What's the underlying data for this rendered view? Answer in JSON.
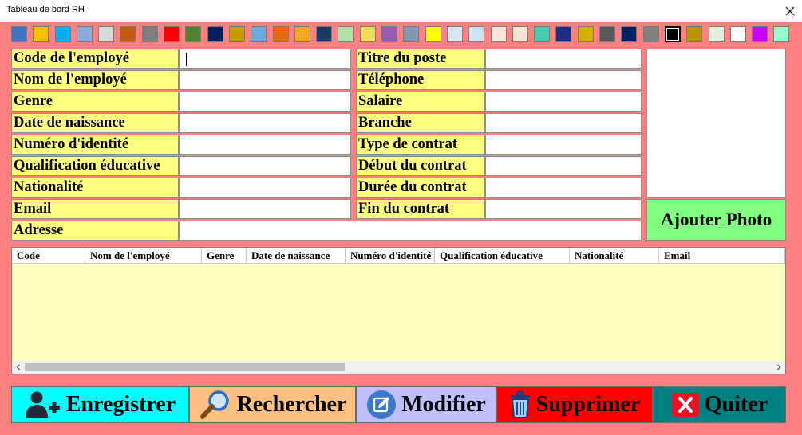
{
  "window": {
    "title": "Tableau de bord RH",
    "close_icon": "close-icon"
  },
  "palette": {
    "swatches": [
      "#4472c4",
      "#ffc000",
      "#00b0f0",
      "#8ea9db",
      "#d9d9d9",
      "#c55a11",
      "#7f7f7f",
      "#ff0000",
      "#548235",
      "#002060",
      "#c99a00",
      "#6fa8dc",
      "#e46c0a",
      "#f5a623",
      "#1f3864",
      "#b4e1a8",
      "#f2dc5d",
      "#9b59b6",
      "#8496b0",
      "#ffff00",
      "#dbe5f1",
      "#cfe2f3",
      "#fce4d6",
      "#fbe4d5",
      "#48c9b0",
      "#1f2d86",
      "#d4b000",
      "#595959",
      "#002060",
      "#808080",
      "#000000",
      "#bf9000",
      "#e2efda",
      "#ffffff",
      "#cc00ff",
      "#99ffcc"
    ],
    "selected_index": 30
  },
  "form": {
    "left_labels": [
      "Code de l'employé",
      "Nom de l'employé",
      "Genre",
      "Date de naissance",
      "Numéro d'identité",
      "Qualification éducative",
      "Nationalité",
      "Email",
      "Adresse"
    ],
    "right_labels": [
      "Titre du poste",
      "Téléphone",
      "Salaire",
      "Branche",
      "Type de contrat",
      "Début du contrat",
      "Durée du contrat",
      "Fin du contrat"
    ],
    "values": {
      "code": "",
      "nom": "",
      "genre": "",
      "naissance": "",
      "identite": "",
      "qualification": "",
      "nationalite": "",
      "email": "",
      "adresse": "",
      "titre": "",
      "telephone": "",
      "salaire": "",
      "branche": "",
      "type_contrat": "",
      "debut": "",
      "duree": "",
      "fin": ""
    }
  },
  "photo": {
    "add_label": "Ajouter Photo"
  },
  "grid": {
    "columns": [
      "Code",
      "Nom de l'employé",
      "Genre",
      "Date de naissance",
      "Numéro d'identité",
      "Qualification éducative",
      "Nationalité",
      "Email"
    ],
    "rows": [],
    "scroll_left_icon": "chevron-left-icon",
    "scroll_right_icon": "chevron-right-icon"
  },
  "actions": {
    "save": {
      "label": "Enregistrer",
      "icon": "add-user-icon",
      "color": "#00ffff"
    },
    "search": {
      "label": "Rechercher",
      "icon": "search-icon",
      "color": "#ffc080"
    },
    "edit": {
      "label": "Modifier",
      "icon": "edit-icon",
      "color": "#c0c0ff"
    },
    "delete": {
      "label": "Supprimer",
      "icon": "trash-icon",
      "color": "#ff0000"
    },
    "quit": {
      "label": "Quiter",
      "icon": "close-box-icon",
      "color": "#008080"
    }
  }
}
